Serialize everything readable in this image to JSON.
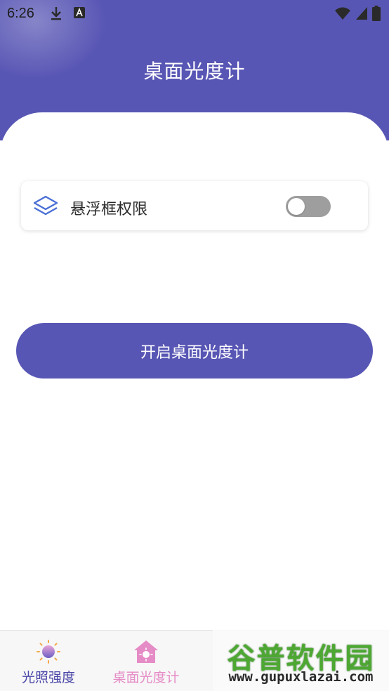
{
  "status_bar": {
    "time": "6:26",
    "left_icons": [
      "download-icon",
      "a-notification-icon"
    ],
    "right_icons": [
      "wifi-icon",
      "signal-icon",
      "battery-icon"
    ]
  },
  "header": {
    "title": "桌面光度计"
  },
  "permission": {
    "icon": "layers-icon",
    "label": "悬浮框权限",
    "enabled": false
  },
  "start_button": {
    "label": "开启桌面光度计"
  },
  "bottom_nav": {
    "items": [
      {
        "label": "光照强度",
        "icon": "sun-icon",
        "active": false
      },
      {
        "label": "桌面光度计",
        "icon": "home-sun-icon",
        "active": true
      },
      {
        "label": "",
        "icon": ""
      },
      {
        "label": "",
        "icon": ""
      }
    ]
  },
  "watermark": {
    "title": "谷普软件园",
    "url": "www.gupuxlazai.com"
  },
  "colors": {
    "primary": "#5856b4",
    "active_tab": "#e58bc6",
    "icon_blue": "#4a6fd6",
    "toggle_off": "#9e9e9e"
  }
}
